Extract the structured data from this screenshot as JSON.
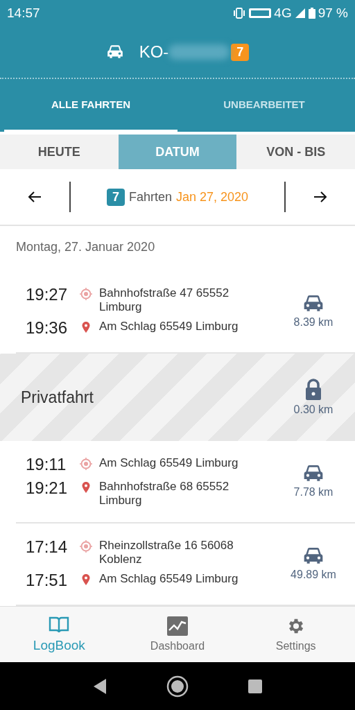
{
  "status_bar": {
    "time": "14:57",
    "network": "4G",
    "battery": "97 %"
  },
  "header": {
    "title": "KO-",
    "count": "7"
  },
  "tabs": [
    {
      "label": "ALLE FAHRTEN",
      "selected": true
    },
    {
      "label": "UNBEARBEITET",
      "selected": false
    }
  ],
  "segments": [
    {
      "label": "HEUTE",
      "selected": false
    },
    {
      "label": "DATUM",
      "selected": true
    },
    {
      "label": "VON - BIS",
      "selected": false
    }
  ],
  "date_nav": {
    "count": "7",
    "label": "Fahrten",
    "date": "Jan 27, 2020"
  },
  "day_heading": "Montag, 27. Januar 2020",
  "trips": [
    {
      "kind": "trip",
      "start_time": "19:27",
      "start": "Bahnhofstraße 47 65552 Limburg",
      "end_time": "19:36",
      "end": "Am Schlag 65549 Limburg",
      "distance": "8.39 km"
    },
    {
      "kind": "private",
      "label": "Privatfahrt",
      "distance": "0.30 km"
    },
    {
      "kind": "trip",
      "start_time": "19:11",
      "start": "Am Schlag 65549 Limburg",
      "end_time": "19:21",
      "end": "Bahnhofstraße 68 65552 Limburg",
      "distance": "7.78 km"
    },
    {
      "kind": "trip",
      "start_time": "17:14",
      "start": "Rheinzollstraße 16 56068 Koblenz",
      "end_time": "17:51",
      "end": "Am Schlag 65549 Limburg",
      "distance": "49.89 km"
    }
  ],
  "bottom_nav": [
    {
      "label": "LogBook",
      "kind": "book",
      "selected": true
    },
    {
      "label": "Dashboard",
      "kind": "chart",
      "selected": false
    },
    {
      "label": "Settings",
      "kind": "gear",
      "selected": false
    }
  ]
}
